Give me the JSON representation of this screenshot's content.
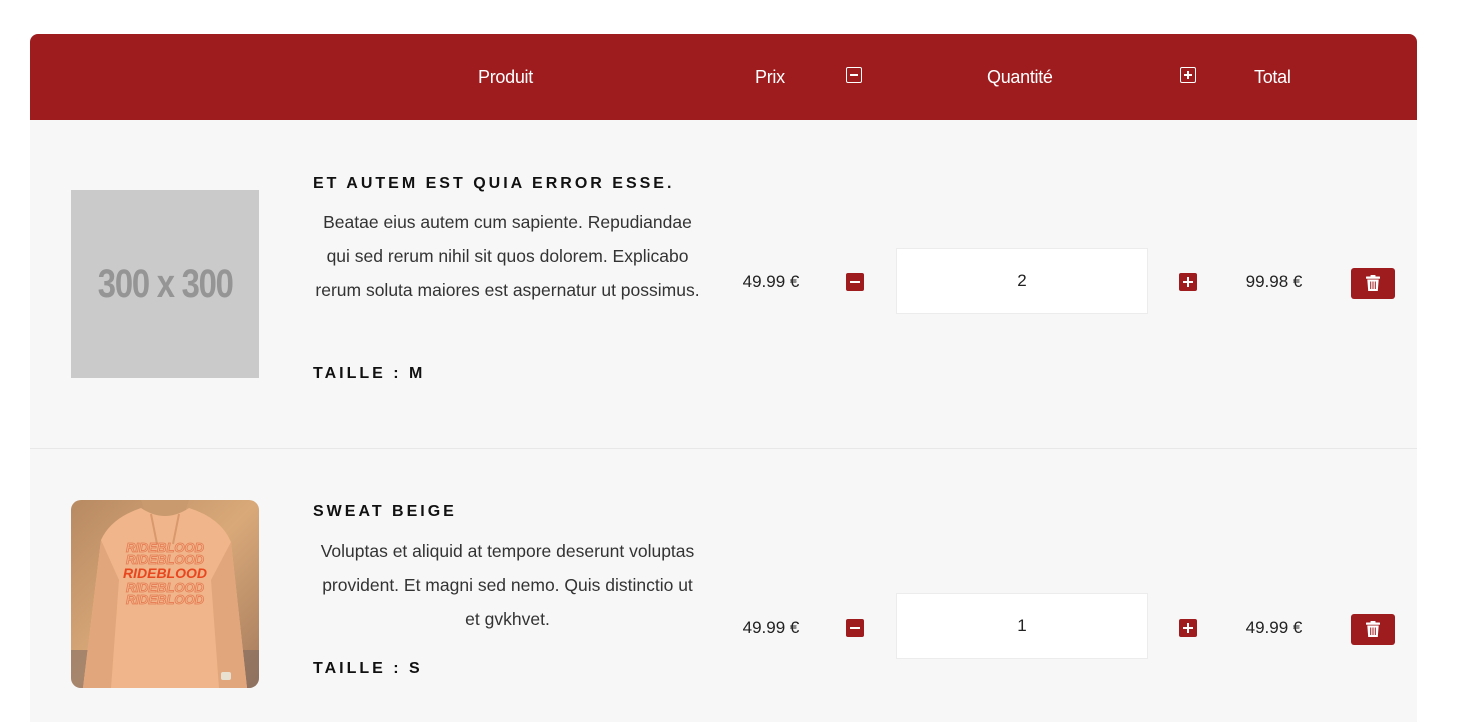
{
  "header": {
    "produit_label": "Produit",
    "prix_label": "Prix",
    "quantite_label": "Quantité",
    "total_label": "Total"
  },
  "colors": {
    "accent": "#9e1b1e",
    "row_background": "#f7f7f7"
  },
  "items": [
    {
      "image_text": "300 x 300",
      "title": "ET AUTEM EST QUIA ERROR ESSE.",
      "description": "Beatae eius autem cum sapiente. Repudiandae qui sed rerum nihil sit quos dolorem. Explicabo rerum soluta maiores est aspernatur ut possimus.",
      "size": "TAILLE : M",
      "price": "49.99 €",
      "quantity": "2",
      "total": "99.98 €"
    },
    {
      "image_text": "RIDEBLOOD",
      "title": "SWEAT BEIGE",
      "description": "Voluptas et aliquid at tempore deserunt voluptas provident. Et magni sed nemo. Quis distinctio ut et gvkhvet.",
      "size": "TAILLE : S",
      "price": "49.99 €",
      "quantity": "1",
      "total": "49.99 €"
    }
  ]
}
